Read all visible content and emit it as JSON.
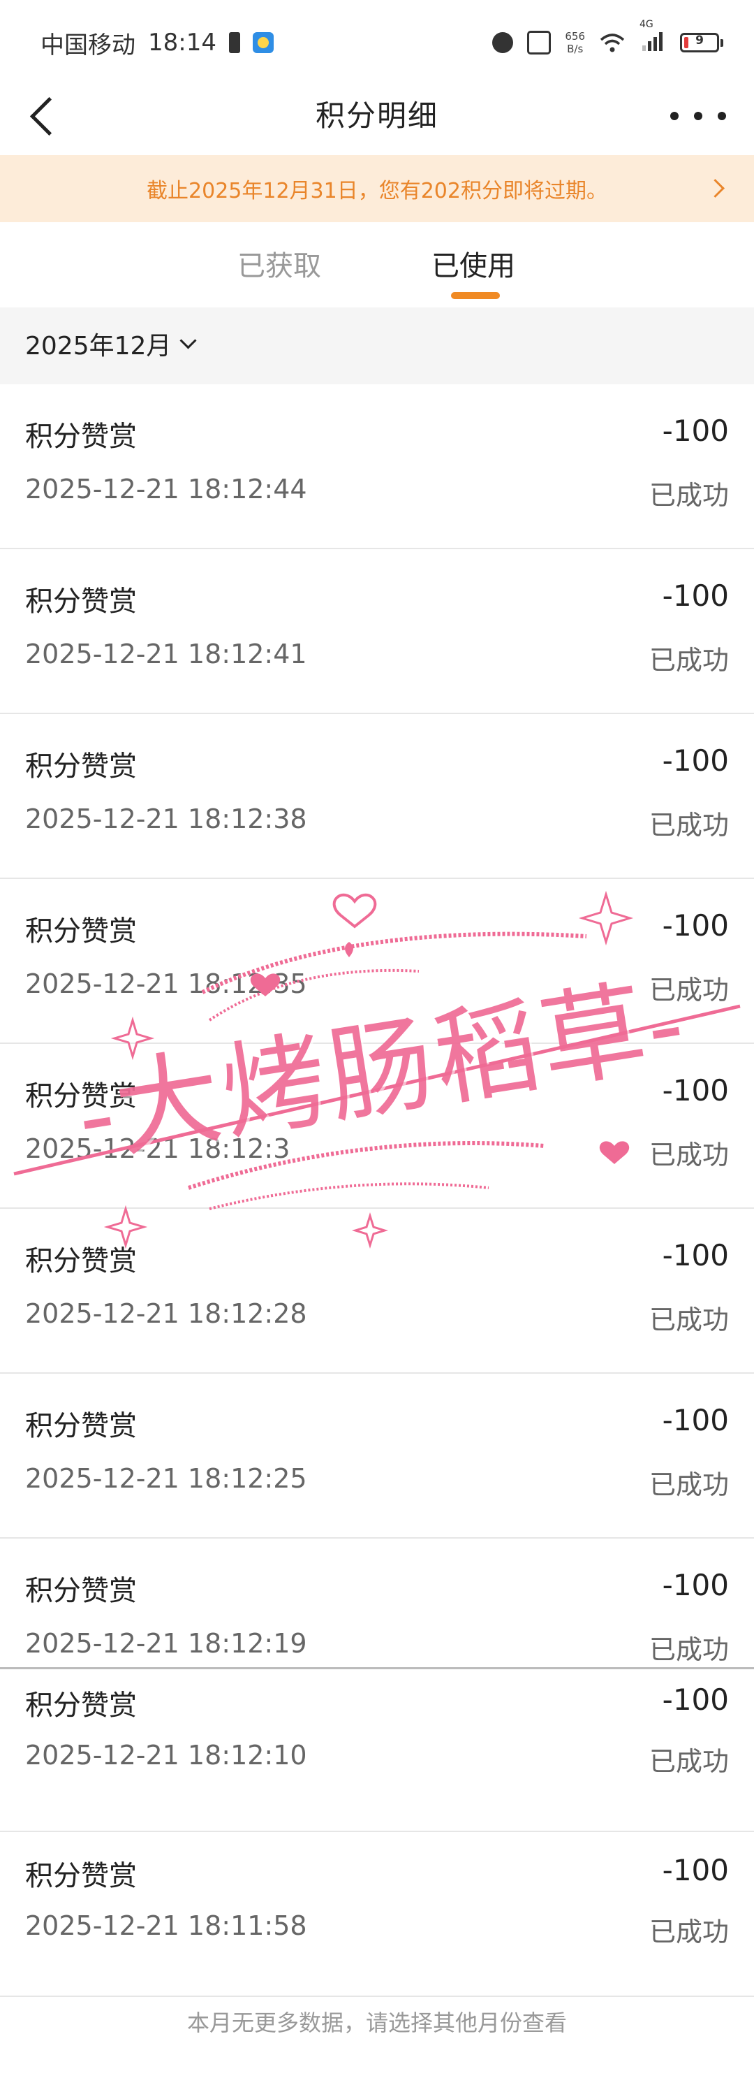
{
  "status_bar": {
    "carrier": "中国移动",
    "time": "18:14",
    "net_speed_value": "656",
    "net_speed_unit": "B/s",
    "network_type": "4G",
    "battery_level": "9"
  },
  "header": {
    "title": "积分明细"
  },
  "notice": {
    "text": "截止2025年12月31日，您有202积分即将过期。"
  },
  "tabs": {
    "earned_label": "已获取",
    "used_label": "已使用",
    "active": "used"
  },
  "filter": {
    "month_label": "2025年12月"
  },
  "records": [
    {
      "title": "积分赞赏",
      "amount": "-100",
      "time": "2025-12-21 18:12:44",
      "status": "已成功"
    },
    {
      "title": "积分赞赏",
      "amount": "-100",
      "time": "2025-12-21 18:12:41",
      "status": "已成功"
    },
    {
      "title": "积分赞赏",
      "amount": "-100",
      "time": "2025-12-21 18:12:38",
      "status": "已成功"
    },
    {
      "title": "积分赞赏",
      "amount": "-100",
      "time": "2025-12-21 18:12:35",
      "status": "已成功"
    },
    {
      "title": "积分赞赏",
      "amount": "-100",
      "time": "2025-12-21 18:12:3",
      "status": "已成功"
    },
    {
      "title": "积分赞赏",
      "amount": "-100",
      "time": "2025-12-21 18:12:28",
      "status": "已成功"
    },
    {
      "title": "积分赞赏",
      "amount": "-100",
      "time": "2025-12-21 18:12:25",
      "status": "已成功"
    },
    {
      "title": "积分赞赏",
      "amount": "-100",
      "time": "2025-12-21 18:12:19",
      "status": "已成功"
    },
    {
      "title": "积分赞赏",
      "amount": "-100",
      "time": "2025-12-21 18:12:10",
      "status": "已成功"
    },
    {
      "title": "积分赞赏",
      "amount": "-100",
      "time": "2025-12-21 18:11:58",
      "status": "已成功"
    }
  ],
  "footer": {
    "text": "本月无更多数据，请选择其他月份查看"
  },
  "watermark": {
    "text": "-大烤肠稻草-",
    "color": "#ef6b95"
  },
  "colors": {
    "accent": "#f08a24",
    "notice_bg": "#fdecd9",
    "notice_text": "#e9852a"
  }
}
